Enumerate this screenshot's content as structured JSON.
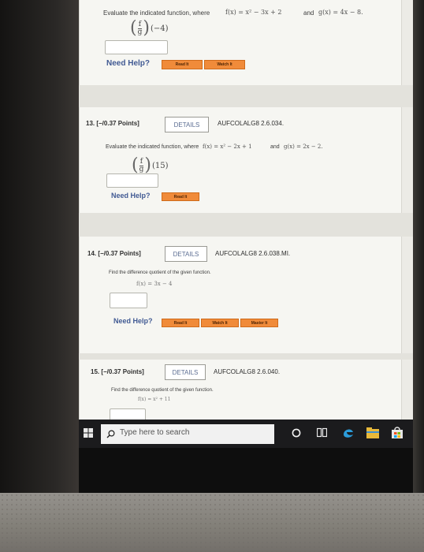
{
  "top_question": {
    "prompt": "Evaluate the indicated function, where",
    "f_def": "f(x) = x² − 3x + 2",
    "and": "and",
    "g_def": "g(x) = 4x − 8.",
    "expr_num": "f",
    "expr_den": "g",
    "expr_arg": "(−4)",
    "help_label": "Need Help?",
    "read_it": "Read It",
    "watch_it": "Watch It"
  },
  "q13": {
    "header": "13. [−/0.37 Points]",
    "details_label": "DETAILS",
    "code": "AUFCOLALG8 2.6.034.",
    "prompt": "Evaluate the indicated function, where",
    "f_def": "f(x) = x² − 2x + 1",
    "and": "and",
    "g_def": "g(x) = 2x − 2.",
    "expr_num": "f",
    "expr_den": "g",
    "expr_arg": "(15)",
    "help_label": "Need Help?",
    "read_it": "Read It"
  },
  "q14": {
    "header": "14. [−/0.37 Points]",
    "details_label": "DETAILS",
    "code": "AUFCOLALG8 2.6.038.MI.",
    "prompt": "Find the difference quotient of the given function.",
    "f_def": "f(x) = 3x − 4",
    "help_label": "Need Help?",
    "read_it": "Read It",
    "watch_it": "Watch It",
    "master_it": "Master It"
  },
  "q15": {
    "header": "15. [−/0.37 Points]",
    "details_label": "DETAILS",
    "code": "AUFCOLALG8 2.6.040.",
    "prompt": "Find the difference quotient of the given function.",
    "f_def": "f(x) = x² + 11"
  },
  "taskbar": {
    "search_placeholder": "Type here to search",
    "colors": {
      "bar": "#1b1b1d",
      "search_bg": "#f1f1f1"
    }
  },
  "theme": {
    "orange_button": "#f08b3a",
    "help_text": "#415a93",
    "details_text": "#5c6e93"
  }
}
